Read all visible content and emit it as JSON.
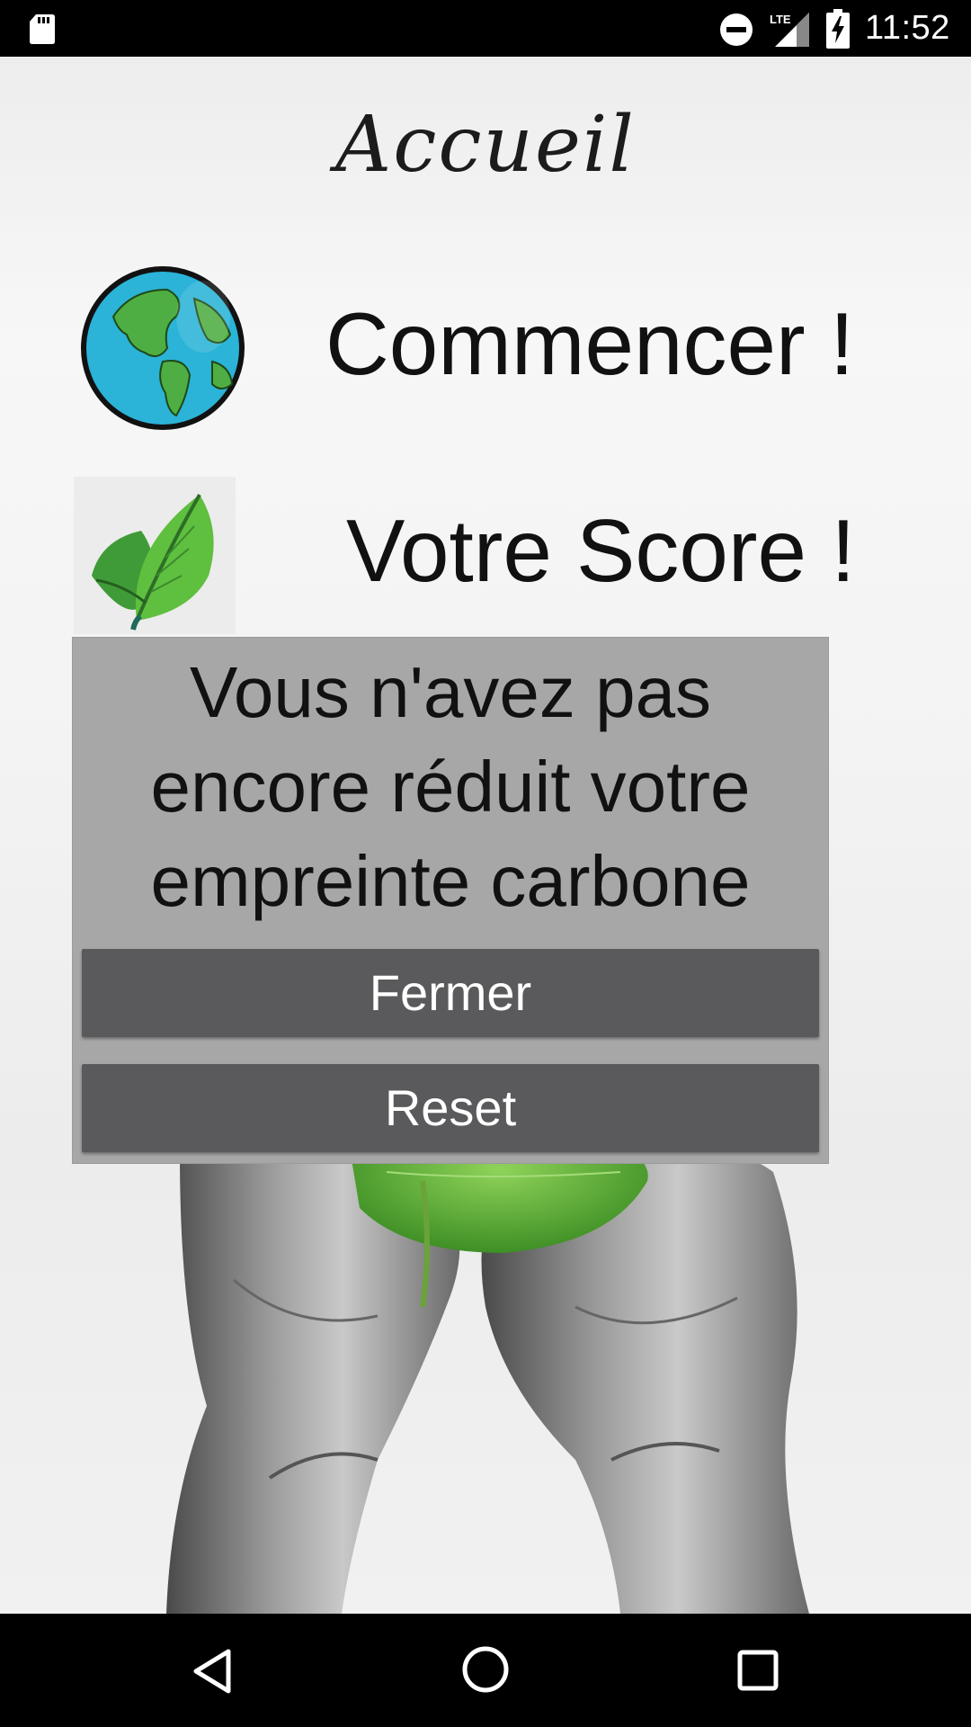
{
  "status_bar": {
    "time": "11:52",
    "network_label": "LTE",
    "icons": [
      "sd-card-icon",
      "do-not-disturb-icon",
      "signal-icon",
      "battery-charging-icon"
    ]
  },
  "page": {
    "title": "Accueil"
  },
  "menu": {
    "start": {
      "label": "Commencer !",
      "icon": "globe-icon"
    },
    "score": {
      "label": "Votre Score !",
      "icon": "leaf-icon"
    }
  },
  "dialog": {
    "message_lines": [
      "Vous n'avez pas",
      "encore réduit votre",
      "empreinte carbone"
    ],
    "close_label": "Fermer",
    "reset_label": "Reset"
  },
  "nav_bar": {
    "icons": [
      "back-icon",
      "home-icon",
      "recent-apps-icon"
    ]
  },
  "colors": {
    "dialog_background": "#a7a7a7",
    "button_background": "#5a5a5c",
    "leaf_green": "#5fbf3f",
    "globe_ocean": "#2bb3d8"
  }
}
